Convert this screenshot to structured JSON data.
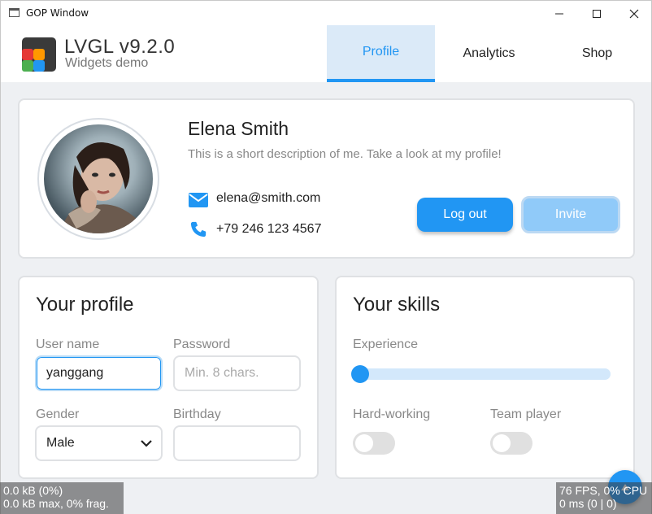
{
  "window": {
    "title": "GOP Window",
    "icons": [
      "app-window-icon",
      "minimize-icon",
      "maximize-icon",
      "close-icon"
    ]
  },
  "header": {
    "title": "LVGL v9.2.0",
    "subtitle": "Widgets demo",
    "tabs": [
      {
        "label": "Profile",
        "active": true
      },
      {
        "label": "Analytics",
        "active": false
      },
      {
        "label": "Shop",
        "active": false
      }
    ],
    "accent": "#2196f3"
  },
  "profile_card": {
    "name": "Elena Smith",
    "description": "This is a short description of me. Take a look at my profile!",
    "email": "elena@smith.com",
    "phone": "+79 246 123 4567",
    "logout_label": "Log out",
    "invite_label": "Invite"
  },
  "your_profile": {
    "title": "Your profile",
    "username_label": "User name",
    "username_value": "yanggang",
    "password_label": "Password",
    "password_placeholder": "Min. 8 chars.",
    "gender_label": "Gender",
    "gender_value": "Male",
    "birthday_label": "Birthday",
    "birthday_value": ""
  },
  "your_skills": {
    "title": "Your skills",
    "experience_label": "Experience",
    "experience_level": 0,
    "hard_working_label": "Hard-working",
    "hard_working_on": false,
    "team_player_label": "Team player",
    "team_player_on": false
  },
  "stats": {
    "mem_line1": "0.0 kB (0%)",
    "mem_line2": "0.0 kB max, 0% frag.",
    "perf_line1": "76 FPS, 0% CPU",
    "perf_line2": "0 ms (0 | 0)"
  }
}
